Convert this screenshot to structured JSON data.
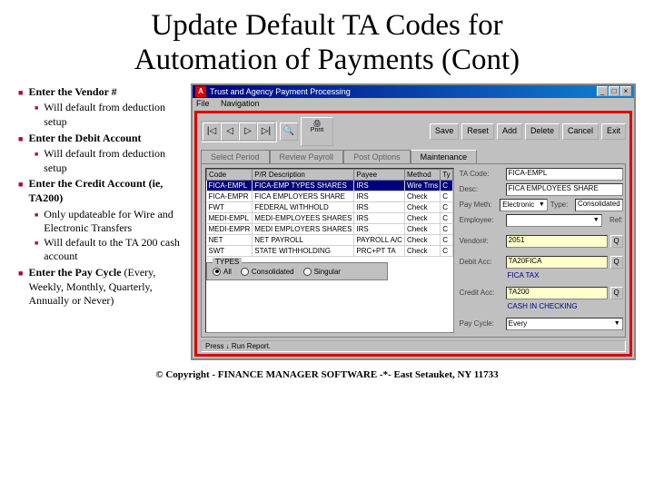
{
  "title_line1": "Update Default TA Codes for",
  "title_line2": "Automation of Payments (Cont)",
  "bullets": {
    "b1": "Enter the Vendor #",
    "b1_1": "Will default from deduction setup",
    "b2": "Enter the Debit Account",
    "b2_1": "Will default from deduction setup",
    "b3": "Enter the Credit Account (ie, TA200)",
    "b3_1": "Only updateable for Wire and Electronic Transfers",
    "b3_2": "Will default to the TA 200 cash account",
    "b4": "Enter the Pay Cycle",
    "b4_1": "(Every, Weekly, Monthly, Quarterly, Annually or Never)"
  },
  "window": {
    "title": "Trust and Agency Payment Processing",
    "menu_file": "File",
    "menu_nav": "Navigation",
    "logo": "A"
  },
  "toolbar": {
    "print_label": "Print",
    "save": "Save",
    "reset": "Reset",
    "add": "Add",
    "delete": "Delete",
    "cancel": "Cancel",
    "exit": "Exit"
  },
  "tabs": {
    "t1": "Select Period",
    "t2": "Review Payroll",
    "t3": "Post Options",
    "t4": "Maintenance"
  },
  "grid": {
    "headers": {
      "h1": "Code",
      "h2": "P/R Description",
      "h3": "Payee",
      "h4": "Method",
      "h5": "Ty"
    },
    "rows": [
      {
        "c": "FICA-EMPL",
        "d": "FICA-EMP TYPES SHARES",
        "p": "IRS",
        "m": "Wire Trns",
        "t": "C"
      },
      {
        "c": "FICA-EMPR",
        "d": "FICA EMPLOYERS SHARE",
        "p": "IRS",
        "m": "Check",
        "t": "C"
      },
      {
        "c": "FWT",
        "d": "FEDERAL WITHHOLD",
        "p": "IRS",
        "m": "Check",
        "t": "C"
      },
      {
        "c": "MEDI-EMPL",
        "d": "MEDI-EMPLOYEES SHARES",
        "p": "IRS",
        "m": "Check",
        "t": "C"
      },
      {
        "c": "MEDI-EMPR",
        "d": "MEDI EMPLOYERS SHARES",
        "p": "IRS",
        "m": "Check",
        "t": "C"
      },
      {
        "c": "NET",
        "d": "NET PAYROLL",
        "p": "PAYROLL A/C",
        "m": "Check",
        "t": "C"
      },
      {
        "c": "SWT",
        "d": "STATE WITHHOLDING",
        "p": "PRC+PT TA",
        "m": "Check",
        "t": "C"
      }
    ]
  },
  "form": {
    "tacode_label": "TA Code:",
    "tacode_value": "FICA-EMPL",
    "desc_label": "Desc:",
    "desc_value": "FICA EMPLOYEES SHARE",
    "paymethod_label": "Pay Meth:",
    "paymethod_value": "Electronic",
    "type_label": "Type:",
    "type_value": "Consolidated",
    "employee_label": "Employee:",
    "employee_value": "",
    "vendor_label": "Vendor#:",
    "vendor_value": "2051",
    "debit_label": "Debit Acc:",
    "debit_value": "TA20FICA",
    "debit_desc": "FICA TAX",
    "credit_label": "Credit Acc:",
    "credit_value": "TA200",
    "credit_desc": "CASH IN CHECKING",
    "paycycle_label": "Pay Cycle:",
    "paycycle_value": "Every"
  },
  "types": {
    "title": "TYPES",
    "all": "All",
    "cons": "Consolidated",
    "sing": "Singular"
  },
  "statusbar": "Press ↓ Run Report.",
  "copyright": "© Copyright - FINANCE MANAGER SOFTWARE -*- East Setauket, NY 11733"
}
